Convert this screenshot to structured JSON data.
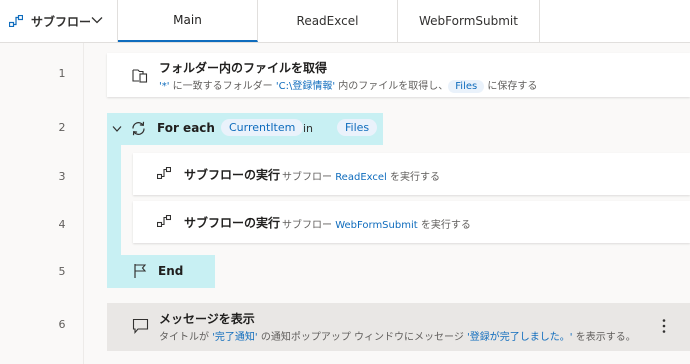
{
  "tabbar": {
    "subflows_label": "サブフロー",
    "tabs": [
      {
        "label": "Main",
        "active": true
      },
      {
        "label": "ReadExcel",
        "active": false
      },
      {
        "label": "WebFormSubmit",
        "active": false
      }
    ]
  },
  "line_numbers": [
    "1",
    "2",
    "3",
    "4",
    "5",
    "6"
  ],
  "actions": {
    "get_files": {
      "title": "フォルダー内のファイルを取得",
      "desc_pattern": "'*'",
      "desc_1": " に一致するフォルダー ",
      "desc_folder": "'C:\\登録情報'",
      "desc_2": " 内のファイルを取得し、",
      "desc_var": "Files",
      "desc_3": " に保存する"
    },
    "foreach": {
      "title": "For each",
      "item_var": "CurrentItem",
      "in_label": "in",
      "list_var": "Files"
    },
    "run_read": {
      "title": "サブフローの実行",
      "desc_1": "サブフロー ",
      "desc_name": "ReadExcel",
      "desc_2": " を実行する"
    },
    "run_web": {
      "title": "サブフローの実行",
      "desc_1": "サブフロー ",
      "desc_name": "WebFormSubmit",
      "desc_2": " を実行する"
    },
    "end": {
      "title": "End"
    },
    "message": {
      "title": "メッセージを表示",
      "desc_1": "タイトルが ",
      "desc_title": "'完了通知'",
      "desc_2": " の通知ポップアップ ウィンドウにメッセージ ",
      "desc_msg": "'登録が完了しました。'",
      "desc_3": " を表示する。"
    }
  },
  "colors": {
    "accent": "#0f6cbd",
    "loop_highlight": "#c8f0f3",
    "token_bg": "#eaf2fb"
  }
}
